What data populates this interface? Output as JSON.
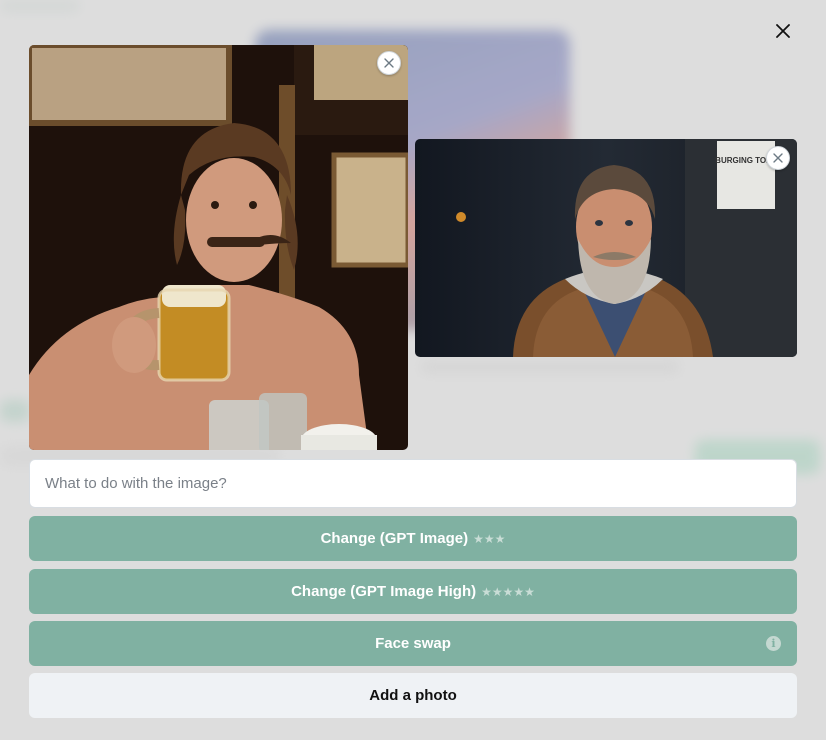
{
  "modal": {
    "close_icon": "close-icon",
    "images": [
      {
        "description": "uploaded photo 1",
        "remove_icon": "close-icon"
      },
      {
        "description": "uploaded photo 2",
        "remove_icon": "close-icon"
      }
    ],
    "prompt": {
      "placeholder": "What to do with the image?",
      "value": ""
    },
    "buttons": {
      "change_gpt": {
        "label": "Change (GPT Image)",
        "stars": "★★★"
      },
      "change_gpt_high": {
        "label": "Change (GPT Image High)",
        "stars": "★★★★★"
      },
      "face_swap": {
        "label": "Face swap",
        "info_icon": "info-icon"
      },
      "add_photo": {
        "label": "Add a photo"
      }
    },
    "photo2_sign_text": "BURGING TOLK"
  },
  "colors": {
    "accent": "#80b1a2",
    "secondary_button": "#eff2f5",
    "overlay": "#e4e4e4"
  }
}
